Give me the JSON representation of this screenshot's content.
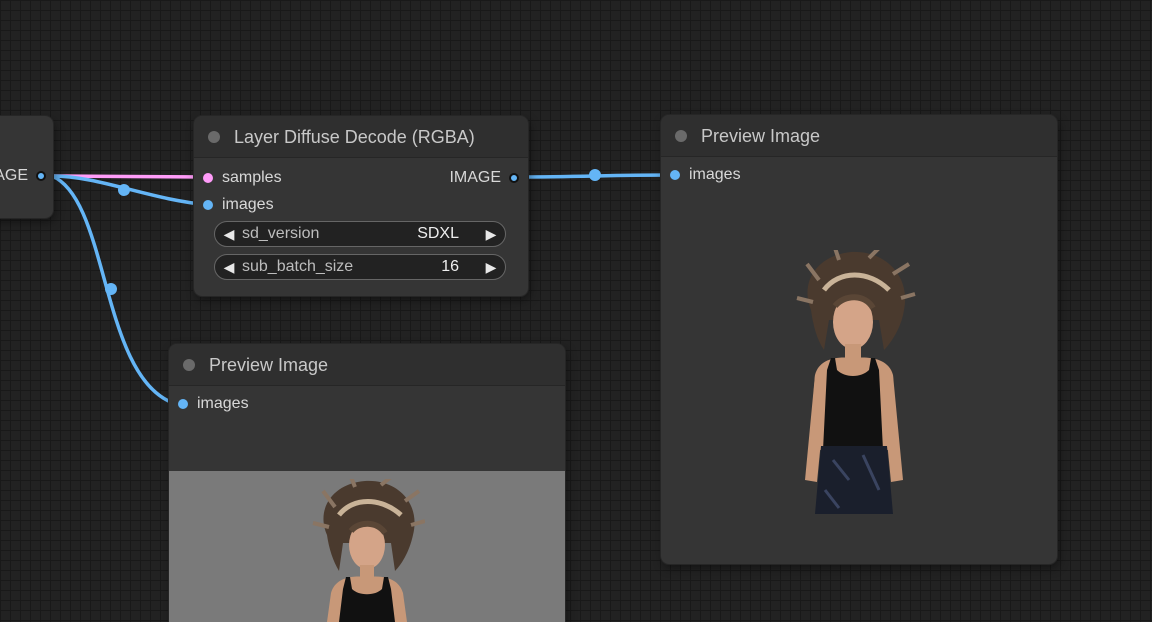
{
  "colors": {
    "canvas_bg": "#222222",
    "node_bg": "#353535",
    "link_image": "#64b5f6",
    "link_latent": "#ff9cf9",
    "preview_bg": "#7a7a7a"
  },
  "source_node": {
    "output_label": "IMAGE"
  },
  "decode_node": {
    "title": "Layer Diffuse Decode (RGBA)",
    "inputs": [
      {
        "label": "samples",
        "color": "#ff9cf9"
      },
      {
        "label": "images",
        "color": "#64b5f6"
      }
    ],
    "output_label": "IMAGE",
    "widgets": [
      {
        "name": "sd_version",
        "value": "SDXL"
      },
      {
        "name": "sub_batch_size",
        "value": "16"
      }
    ]
  },
  "preview_right": {
    "title": "Preview Image",
    "input_label": "images"
  },
  "preview_bottom": {
    "title": "Preview Image",
    "input_label": "images"
  },
  "icons": {
    "collapse": "collapse-dot-icon",
    "decrement": "left-arrow-icon",
    "increment": "right-arrow-icon"
  }
}
